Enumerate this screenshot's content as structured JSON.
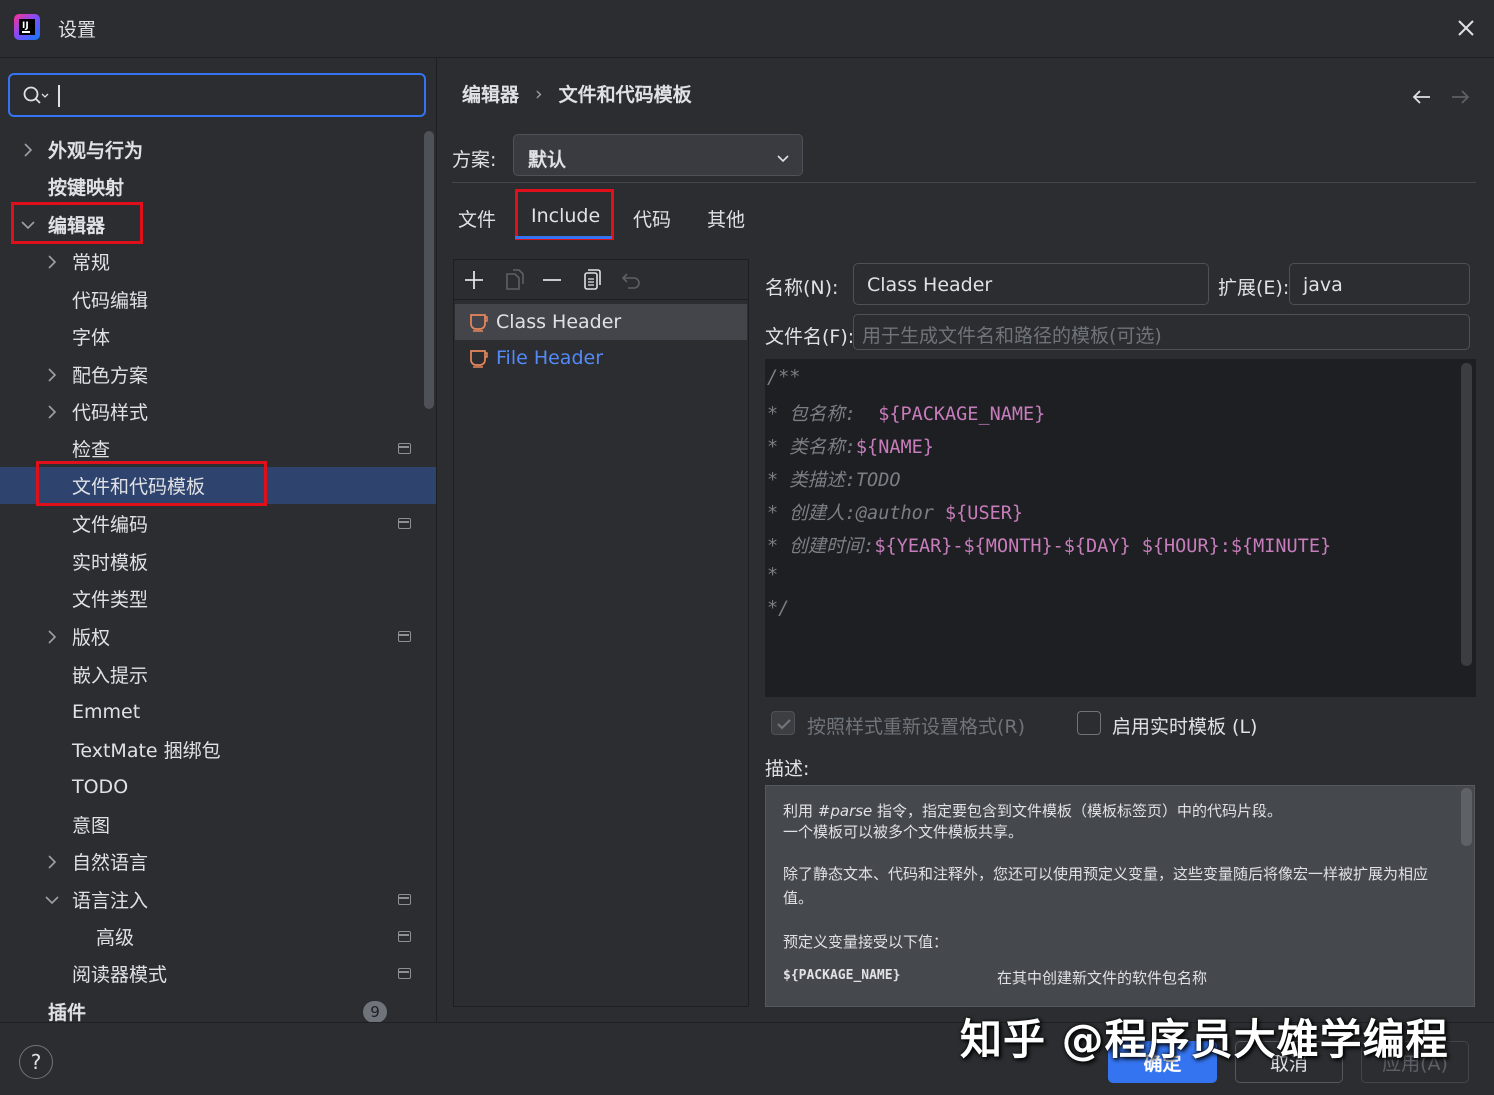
{
  "window": {
    "title": "设置"
  },
  "sidebar": {
    "search_value": "",
    "items": [
      {
        "label": "外观与行为",
        "bold": true
      },
      {
        "label": "按键映射",
        "bold": true
      },
      {
        "label": "编辑器",
        "bold": true
      },
      {
        "label": "常规"
      },
      {
        "label": "代码编辑"
      },
      {
        "label": "字体"
      },
      {
        "label": "配色方案"
      },
      {
        "label": "代码样式"
      },
      {
        "label": "检查"
      },
      {
        "label": "文件和代码模板"
      },
      {
        "label": "文件编码"
      },
      {
        "label": "实时模板"
      },
      {
        "label": "文件类型"
      },
      {
        "label": "版权"
      },
      {
        "label": "嵌入提示"
      },
      {
        "label": "Emmet"
      },
      {
        "label": "TextMate 捆绑包"
      },
      {
        "label": "TODO"
      },
      {
        "label": "意图"
      },
      {
        "label": "自然语言"
      },
      {
        "label": "语言注入"
      },
      {
        "label": "高级"
      },
      {
        "label": "阅读器模式"
      },
      {
        "label": "插件",
        "bold": true,
        "badge": "9"
      }
    ]
  },
  "breadcrumb": {
    "parent": "编辑器",
    "separator": "›",
    "current": "文件和代码模板"
  },
  "scheme": {
    "label": "方案:",
    "value": "默认"
  },
  "tabs": [
    "文件",
    "Include",
    "代码",
    "其他"
  ],
  "active_tab": "Include",
  "templates": [
    {
      "name": "Class Header",
      "selected": true
    },
    {
      "name": "File Header",
      "selected": false
    }
  ],
  "form": {
    "name_label": "名称(N):",
    "name_value": "Class Header",
    "ext_label": "扩展(E):",
    "ext_value": "java",
    "filename_label": "文件名(F):",
    "filename_placeholder": "用于生成文件名和路径的模板(可选)"
  },
  "code": {
    "l1": "/**",
    "l2_star": "* ",
    "l2_text": "包名称:  ",
    "l2_var": "${PACKAGE_NAME}",
    "l3_star": "* ",
    "l3_text": "类名称:",
    "l3_var": "${NAME}",
    "l4_star": "* ",
    "l4_text": "类描述:TODO",
    "l5_star": "* ",
    "l5_text": "创建人:@author ",
    "l5_var": "${USER}",
    "l6_star": "* ",
    "l6_text": "创建时间:",
    "l6_v1": "${YEAR}",
    "l6_d1": "-",
    "l6_v2": "${MONTH}",
    "l6_d2": "-",
    "l6_v3": "${DAY}",
    "l6_sp": " ",
    "l6_v4": "${HOUR}",
    "l6_c": ":",
    "l6_v5": "${MINUTE}",
    "l7": "*",
    "l8": "*/"
  },
  "options": {
    "reformat_label": "按照样式重新设置格式(R)",
    "reformat_checked": true,
    "live_template_label": "启用实时模板 (L)",
    "live_template_checked": false
  },
  "description": {
    "label": "描述:",
    "p1_a": "利用 ",
    "p1_em": "#parse",
    "p1_b": " 指令，指定要包含到文件模板（模板标签页）中的代码片段。",
    "p2": "一个模板可以被多个文件模板共享。",
    "p3": "除了静态文本、代码和注释外，您还可以使用预定义变量，这些变量随后将像宏一样被扩展为相应",
    "p4": "值。",
    "p5": "预定义变量接受以下值：",
    "var_name": "${PACKAGE_NAME}",
    "var_desc": "在其中创建新文件的软件包名称"
  },
  "footer": {
    "help": "?",
    "ok": "确定",
    "cancel": "取消",
    "apply": "应用(A)"
  },
  "watermark": "知乎 @程序员大雄学编程",
  "colors": {
    "accent": "#3574f0",
    "highlight_box": "#e0101a",
    "selection": "#2e436e",
    "template_var": "#c77dbb"
  }
}
